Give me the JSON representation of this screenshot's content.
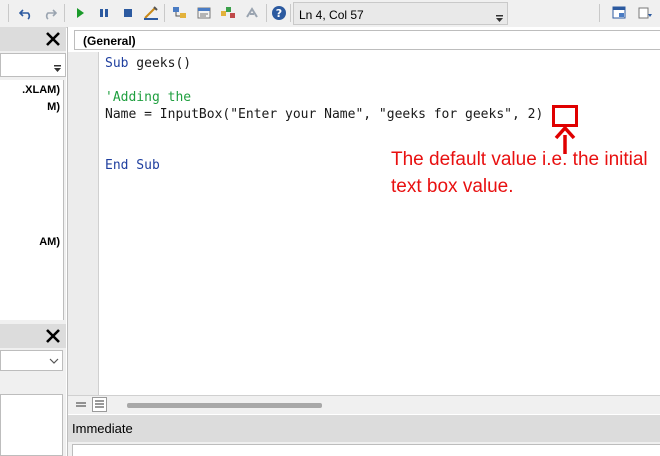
{
  "toolbar": {
    "buttons": [
      "undo-icon",
      "redo-icon",
      "run-icon",
      "pause-icon",
      "stop-icon",
      "design-mode-icon",
      "project-explorer-icon",
      "properties-icon",
      "object-browser-icon",
      "toolbox-icon",
      "help-icon"
    ],
    "status": "Ln 4, Col 57"
  },
  "project_tree": {
    "items": [
      ".XLAM)",
      "M)",
      "AM)"
    ]
  },
  "code_window": {
    "object_combo": "(General)",
    "lines": {
      "l1_kw": "Sub",
      "l1_rest": " geeks()",
      "l3": "'Adding the",
      "l4_a": "Name = InputBox(\"Enter your Name\", \"geeks for geeks\",",
      "l4_b": " 2)",
      "l7": "End Sub"
    }
  },
  "annotation": {
    "line1": "The default value i.e. the initial",
    "line2": "text box value."
  },
  "immediate": {
    "title": "Immediate"
  },
  "colors": {
    "accent": "#e81010",
    "keyword": "#1f3f9f",
    "comment": "#1f9f3f"
  }
}
